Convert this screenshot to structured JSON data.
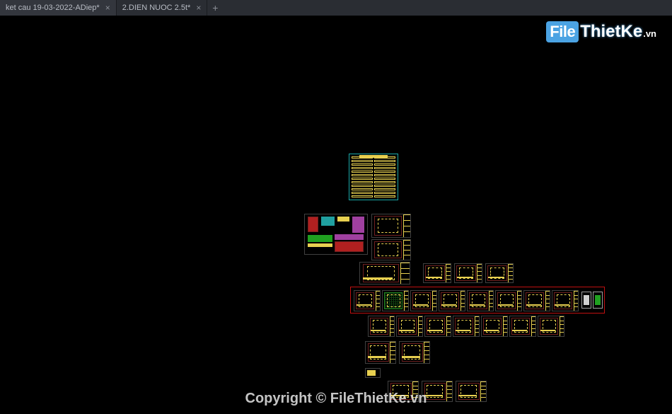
{
  "tabs": [
    {
      "label": "ket cau 19-03-2022-ADiep*",
      "active": true
    },
    {
      "label": "2.DIEN NUOC 2.5t*",
      "active": false
    }
  ],
  "logo": {
    "part1": "File",
    "part2": "ThietKe",
    "part3": ".vn"
  },
  "copyright": "Copyright © FileThietKe.vn",
  "index_box": {
    "rows_per_col": 12
  },
  "sheet_rows": {
    "row_a_count": 3,
    "row_b_count": 3,
    "row_c_count": 8,
    "row_d_count": 7,
    "row_e_count": 2,
    "row_f_count": 3
  }
}
